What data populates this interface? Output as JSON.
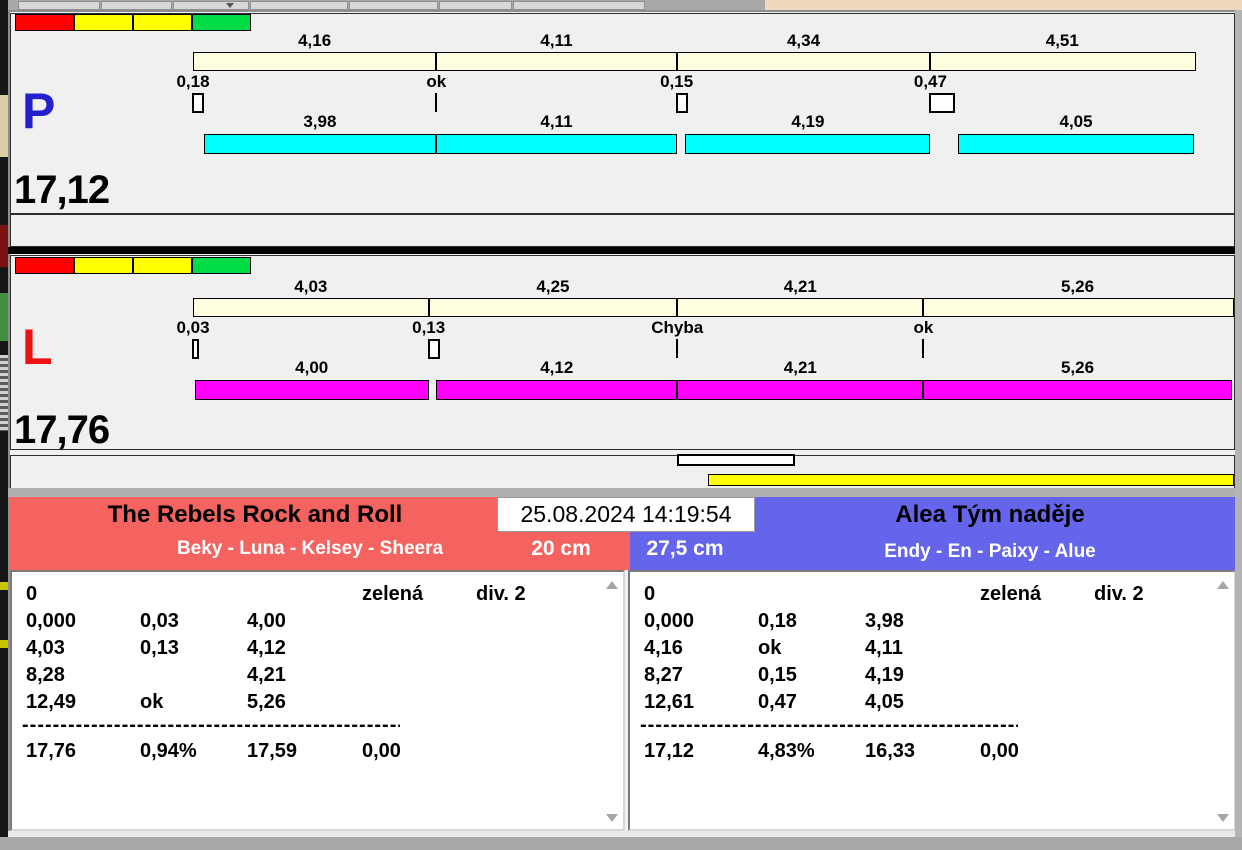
{
  "lanes": [
    {
      "id": "P",
      "letter": "P",
      "letter_color": "#2222cc",
      "total": "17,12",
      "bar_color": "#00ffff",
      "split_bar_color": "#ffffdf",
      "indicator_colors": [
        "#ff0000",
        "#ffff00",
        "#ffff00",
        "#00dc46"
      ],
      "split_labels": [
        "4,16",
        "4,11",
        "4,34",
        "4,51"
      ],
      "boundaries": [
        0,
        4.16,
        8.27,
        12.61,
        17.12
      ],
      "change_markers": [
        {
          "label": "0,18",
          "type": "box",
          "offset": 0.18
        },
        {
          "label": "ok",
          "type": "tick",
          "offset": 0
        },
        {
          "label": "0,15",
          "type": "box",
          "offset": 0.15
        },
        {
          "label": "0,47",
          "type": "bigbox",
          "offset": 0.47
        }
      ],
      "dog_labels": [
        "3,98",
        "4,11",
        "4,19",
        "4,05"
      ]
    },
    {
      "id": "L",
      "letter": "L",
      "letter_color": "#ee1111",
      "total": "17,76",
      "bar_color": "#ff00ff",
      "split_bar_color": "#ffffdf",
      "indicator_colors": [
        "#ff0000",
        "#ffff00",
        "#ffff00",
        "#00dc46"
      ],
      "split_labels": [
        "4,03",
        "4,25",
        "4,21",
        "5,26"
      ],
      "boundaries": [
        0,
        4.03,
        8.28,
        12.49,
        17.76
      ],
      "change_markers": [
        {
          "label": "0,03",
          "type": "thinbox",
          "offset": 0.03
        },
        {
          "label": "0,13",
          "type": "box",
          "offset": 0.13
        },
        {
          "label": "Chyba",
          "type": "tick",
          "offset": 0
        },
        {
          "label": "ok",
          "type": "tick",
          "offset": 0
        }
      ],
      "dog_labels": [
        "4,00",
        "4,12",
        "4,21",
        "5,26"
      ]
    }
  ],
  "scoreboard": {
    "timestamp": "25.08.2024 14:19:54",
    "left": {
      "team": "The Rebels Rock and Roll",
      "dogs": "Beky - Luna - Kelsey - Sheera",
      "height": "20 cm",
      "header_color": "#f4635f",
      "rows": [
        [
          "0",
          "",
          "",
          "zelená",
          "div. 2"
        ],
        [
          "0,000",
          "0,03",
          "4,00",
          "",
          ""
        ],
        [
          "4,03",
          "0,13",
          "4,12",
          "",
          ""
        ],
        [
          "8,28",
          "",
          "4,21",
          "",
          ""
        ],
        [
          "12,49",
          "ok",
          "5,26",
          "",
          ""
        ]
      ],
      "separator": "--------------------------------------------------",
      "totals": [
        "17,76",
        "0,94%",
        "17,59",
        "0,00"
      ]
    },
    "right": {
      "team": "Alea Tým naděje",
      "dogs": "Endy - En - Paixy - Alue",
      "height": "27,5 cm",
      "header_color": "#6565ec",
      "rows": [
        [
          "0",
          "",
          "",
          "zelená",
          "div. 2"
        ],
        [
          "0,000",
          "0,18",
          "3,98",
          "",
          ""
        ],
        [
          "4,16",
          "ok",
          "4,11",
          "",
          ""
        ],
        [
          "8,27",
          "0,15",
          "4,19",
          "",
          ""
        ],
        [
          "12,61",
          "0,47",
          "4,05",
          "",
          ""
        ]
      ],
      "separator": "--------------------------------------------------",
      "totals": [
        "17,12",
        "4,83%",
        "16,33",
        "0,00"
      ]
    }
  }
}
